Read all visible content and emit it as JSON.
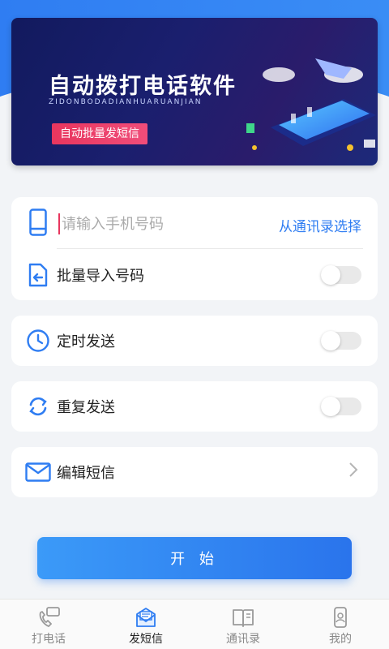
{
  "banner": {
    "title": "自动拨打电话软件",
    "subtitle": "ZIDONBODADIANHUARUANJIAN",
    "tag": "自动批量发短信"
  },
  "phone_row": {
    "placeholder": "请输入手机号码",
    "value": "",
    "contacts_link": "从通讯录选择"
  },
  "batch_row": {
    "label": "批量导入号码",
    "toggle_on": false
  },
  "schedule_row": {
    "label": "定时发送",
    "toggle_on": false
  },
  "repeat_row": {
    "label": "重复发送",
    "toggle_on": false
  },
  "edit_row": {
    "label": "编辑短信"
  },
  "start_button": {
    "label": "开 始"
  },
  "tabs": [
    {
      "label": "打电话",
      "icon": "phone-chat-icon",
      "active": false
    },
    {
      "label": "发短信",
      "icon": "sms-envelope-icon",
      "active": true
    },
    {
      "label": "通讯录",
      "icon": "contacts-book-icon",
      "active": false
    },
    {
      "label": "我的",
      "icon": "profile-phone-icon",
      "active": false
    }
  ],
  "colors": {
    "accent": "#2f7df2",
    "banner_pill": "#e8365e",
    "page_bg": "#f2f4f7"
  }
}
